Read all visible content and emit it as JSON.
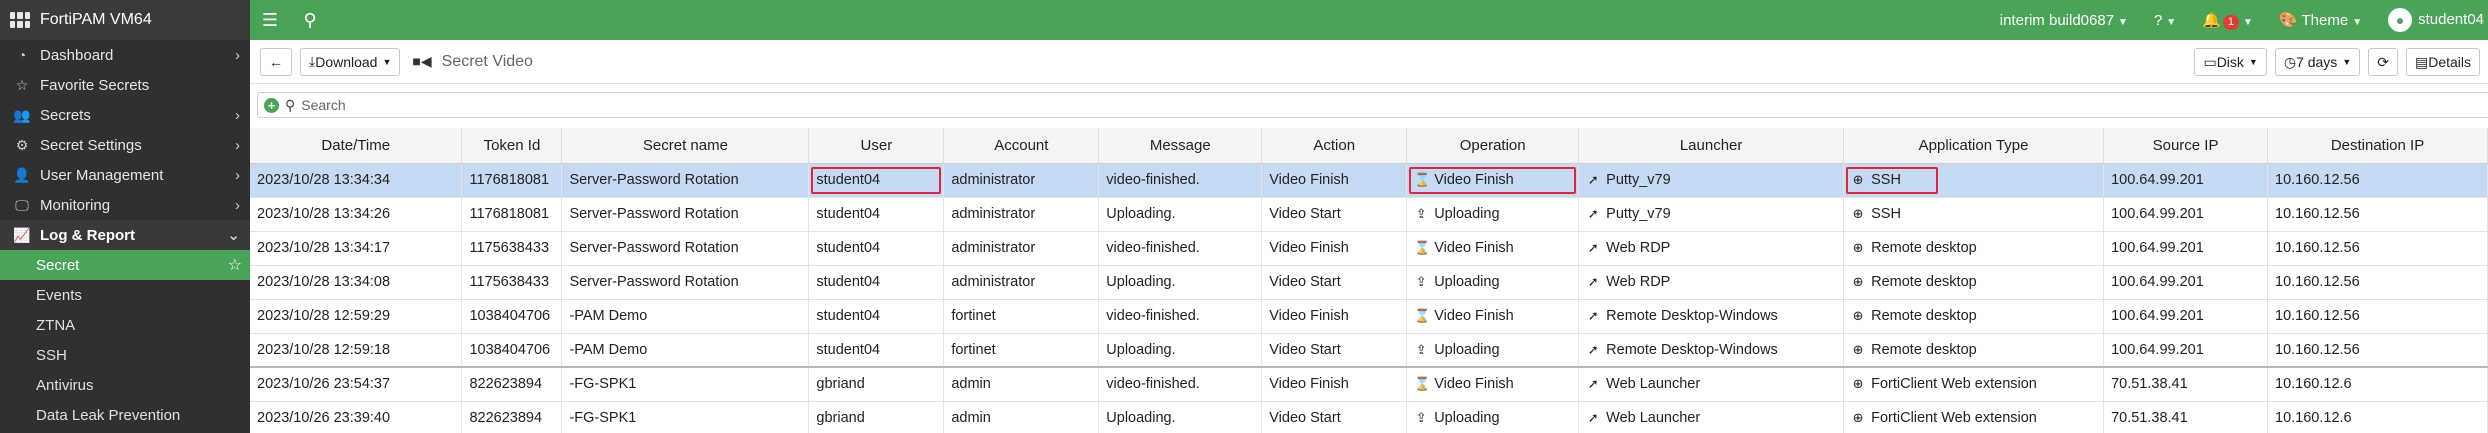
{
  "sidebar": {
    "brand": "FortiPAM VM64",
    "items": [
      {
        "label": "Dashboard",
        "icon": "dashboard-icon",
        "glyph": "◔",
        "chevron": "›"
      },
      {
        "label": "Favorite Secrets",
        "icon": "star-icon",
        "glyph": "☆",
        "chevron": ""
      },
      {
        "label": "Secrets",
        "icon": "users-icon",
        "glyph": "👥",
        "chevron": "›"
      },
      {
        "label": "Secret Settings",
        "icon": "sliders-icon",
        "glyph": "⚙",
        "chevron": "›"
      },
      {
        "label": "User Management",
        "icon": "user-icon",
        "glyph": "👤",
        "chevron": "›"
      },
      {
        "label": "Monitoring",
        "icon": "monitor-icon",
        "glyph": "🖵",
        "chevron": "›"
      }
    ],
    "open_section": {
      "label": "Log & Report",
      "icon": "chart-icon",
      "glyph": "📈",
      "chevron": "⌄"
    },
    "subitems": [
      "Secret",
      "Events",
      "ZTNA",
      "SSH",
      "Antivirus",
      "Data Leak Prevention"
    ]
  },
  "topbar": {
    "build": "interim build0687",
    "notifications": "1",
    "theme": "Theme",
    "user": "student04"
  },
  "toolbar": {
    "download": "Download",
    "title": "Secret Video",
    "disk": "Disk",
    "range": "7 days",
    "details": "Details"
  },
  "search": {
    "placeholder": "Search"
  },
  "table": {
    "columns": [
      "Date/Time",
      "Token Id",
      "Secret name",
      "User",
      "Account",
      "Message",
      "Action",
      "Operation",
      "Launcher",
      "Application Type",
      "Source IP",
      "Destination IP"
    ],
    "rows": [
      {
        "datetime": "2023/10/28 13:34:34",
        "token": "1176818081",
        "secret": "Server-Password Rotation",
        "user": "student04",
        "account": "administrator",
        "message": "video-finished.",
        "action": "Video Finish",
        "operation": "Video Finish",
        "op_icon": "hourglass-icon",
        "launcher": "Putty_v79",
        "app": "SSH",
        "src": "100.64.99.201",
        "dst": "10.160.12.56"
      },
      {
        "datetime": "2023/10/28 13:34:26",
        "token": "1176818081",
        "secret": "Server-Password Rotation",
        "user": "student04",
        "account": "administrator",
        "message": "Uploading.",
        "action": "Video Start",
        "operation": "Uploading",
        "op_icon": "upload-icon",
        "launcher": "Putty_v79",
        "app": "SSH",
        "src": "100.64.99.201",
        "dst": "10.160.12.56"
      },
      {
        "datetime": "2023/10/28 13:34:17",
        "token": "1175638433",
        "secret": "Server-Password Rotation",
        "user": "student04",
        "account": "administrator",
        "message": "video-finished.",
        "action": "Video Finish",
        "operation": "Video Finish",
        "op_icon": "hourglass-icon",
        "launcher": "Web RDP",
        "app": "Remote desktop",
        "src": "100.64.99.201",
        "dst": "10.160.12.56"
      },
      {
        "datetime": "2023/10/28 13:34:08",
        "token": "1175638433",
        "secret": "Server-Password Rotation",
        "user": "student04",
        "account": "administrator",
        "message": "Uploading.",
        "action": "Video Start",
        "operation": "Uploading",
        "op_icon": "upload-icon",
        "launcher": "Web RDP",
        "app": "Remote desktop",
        "src": "100.64.99.201",
        "dst": "10.160.12.56"
      },
      {
        "datetime": "2023/10/28 12:59:29",
        "token": "1038404706",
        "secret": "-PAM Demo",
        "user": "student04",
        "account": "fortinet",
        "message": "video-finished.",
        "action": "Video Finish",
        "operation": "Video Finish",
        "op_icon": "hourglass-icon",
        "launcher": "Remote Desktop-Windows",
        "app": "Remote desktop",
        "src": "100.64.99.201",
        "dst": "10.160.12.56"
      },
      {
        "datetime": "2023/10/28 12:59:18",
        "token": "1038404706",
        "secret": "-PAM Demo",
        "user": "student04",
        "account": "fortinet",
        "message": "Uploading.",
        "action": "Video Start",
        "operation": "Uploading",
        "op_icon": "upload-icon",
        "launcher": "Remote Desktop-Windows",
        "app": "Remote desktop",
        "src": "100.64.99.201",
        "dst": "10.160.12.56"
      },
      {
        "datetime": "2023/10/26 23:54:37",
        "token": "822623894",
        "secret": "-FG-SPK1",
        "user": "gbriand",
        "account": "admin",
        "message": "video-finished.",
        "action": "Video Finish",
        "operation": "Video Finish",
        "op_icon": "hourglass-icon",
        "launcher": "Web Launcher",
        "app": "FortiClient Web extension",
        "src": "70.51.38.41",
        "dst": "10.160.12.6"
      },
      {
        "datetime": "2023/10/26 23:39:40",
        "token": "822623894",
        "secret": "-FG-SPK1",
        "user": "gbriand",
        "account": "admin",
        "message": "Uploading.",
        "action": "Video Start",
        "operation": "Uploading",
        "op_icon": "upload-icon",
        "launcher": "Web Launcher",
        "app": "FortiClient Web extension",
        "src": "70.51.38.41",
        "dst": "10.160.12.6"
      }
    ]
  },
  "colors": {
    "brand_green": "#4aa458",
    "sidebar_bg": "#2f3032",
    "selected_row": "#c7daf3",
    "highlight_box": "#e0263a"
  }
}
